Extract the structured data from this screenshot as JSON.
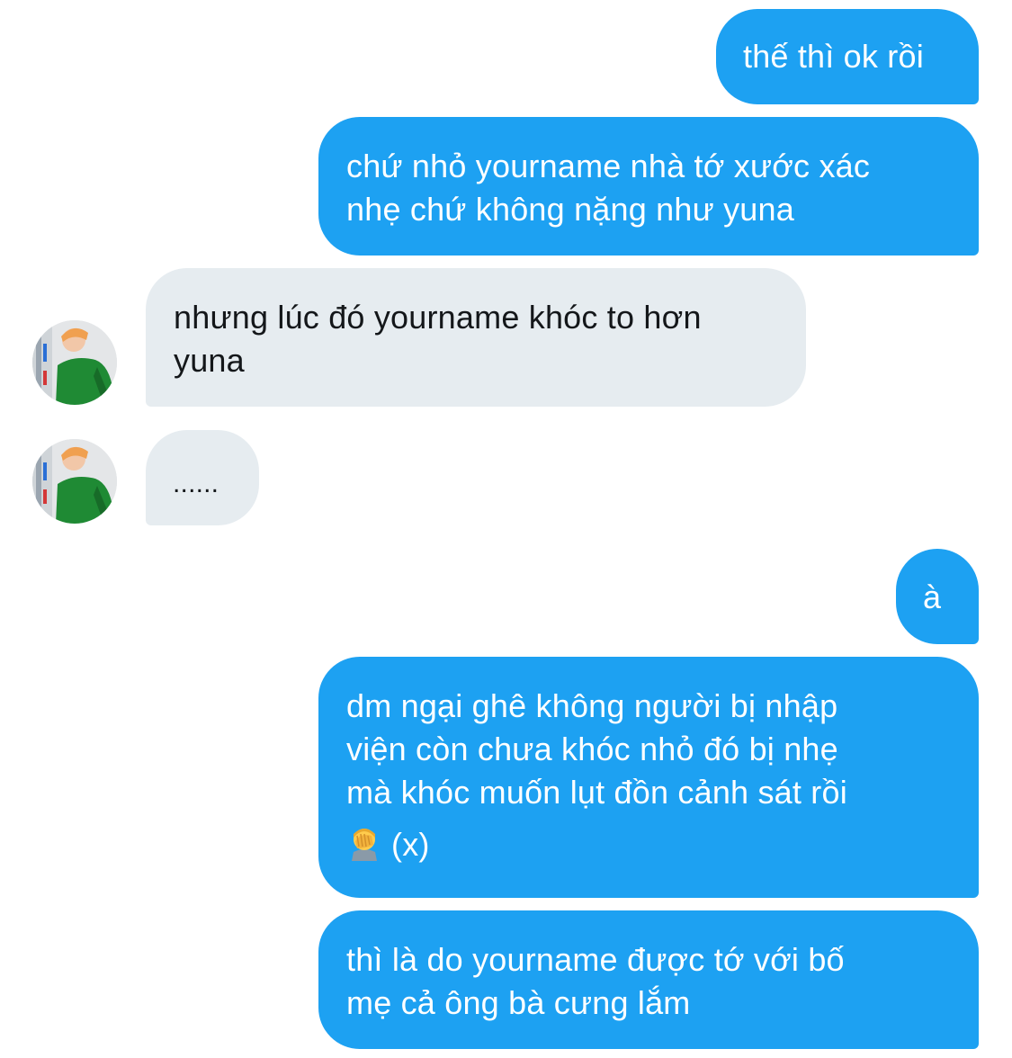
{
  "conversation": {
    "messages": [
      {
        "direction": "outgoing",
        "text": "thế thì ok rồi"
      },
      {
        "direction": "outgoing",
        "lines": [
          "chứ nhỏ yourname nhà tớ xước xác",
          "nhẹ chứ không nặng như yuna"
        ]
      },
      {
        "direction": "incoming",
        "lines": [
          "nhưng lúc đó yourname khóc to hơn",
          "yuna"
        ]
      },
      {
        "direction": "incoming",
        "text": "......"
      },
      {
        "direction": "outgoing",
        "text": "à"
      },
      {
        "direction": "outgoing",
        "lines": [
          "dm ngại ghê không người bị nhập",
          "viện còn chưa khóc nhỏ đó bị nhẹ",
          "mà khóc muốn lụt đồn cảnh sát rồi"
        ],
        "trailing_text": "(x)",
        "emoji": "face-palm-emoji"
      },
      {
        "direction": "outgoing",
        "lines": [
          "thì là do yourname được tớ với bố",
          "mẹ cả ông bà cưng lắm"
        ]
      }
    ]
  },
  "colors": {
    "outgoing_bubble": "#1da1f2",
    "outgoing_text": "#ffffff",
    "incoming_bubble": "#e6ecf0",
    "incoming_text": "#14171a",
    "background": "#ffffff"
  },
  "icons": {
    "avatar": "contact-avatar-photo"
  }
}
